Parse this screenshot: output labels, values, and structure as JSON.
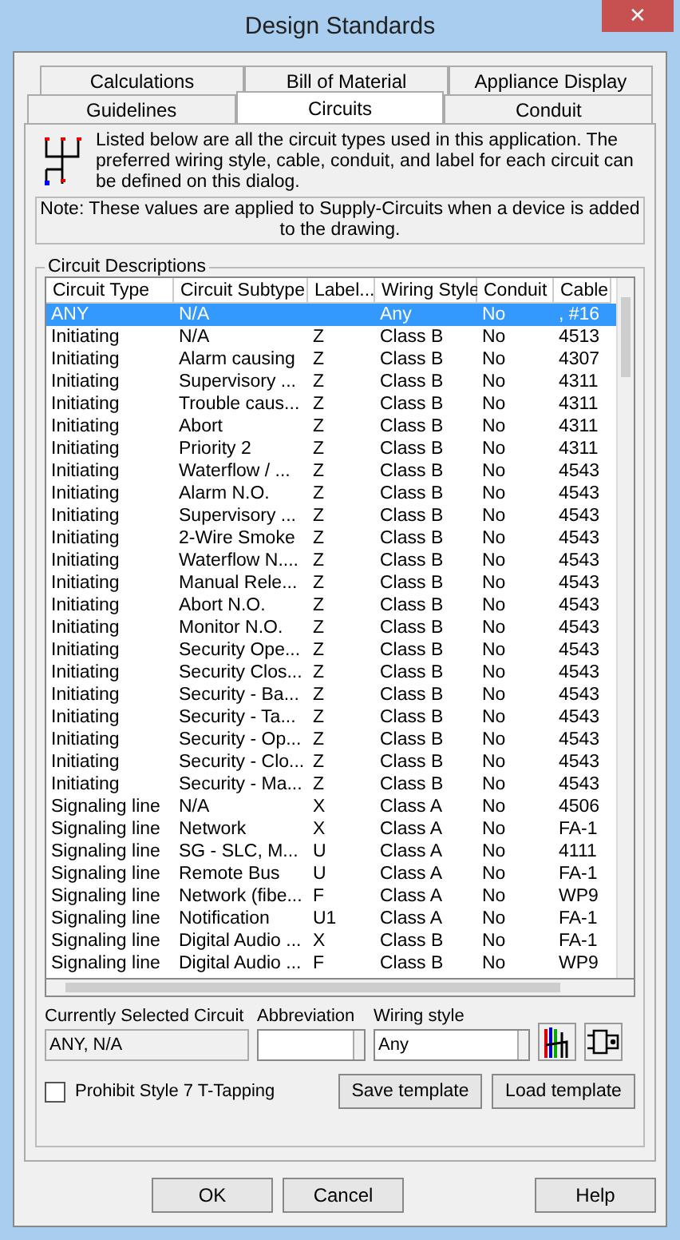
{
  "window": {
    "title": "Design Standards",
    "close": "✕"
  },
  "tab_rows": [
    [
      {
        "label": "Calculations",
        "selected": false
      },
      {
        "label": "Bill of Material",
        "selected": false
      },
      {
        "label": "Appliance Display",
        "selected": false
      }
    ],
    [
      {
        "label": "Guidelines",
        "selected": false
      },
      {
        "label": "Circuits",
        "selected": true
      },
      {
        "label": "Conduit",
        "selected": false
      }
    ]
  ],
  "intro": "Listed below are all the circuit types used in this application.  The preferred wiring style, cable, conduit, and label for each circuit can be defined on this dialog.",
  "note": "Note: These values are applied to Supply-Circuits when a device is added to the drawing.",
  "group_title": "Circuit Descriptions",
  "table": {
    "columns": [
      "Circuit Type",
      "Circuit Subtype",
      "Label...",
      "Wiring Style",
      "Conduit",
      "Cable"
    ],
    "rows": [
      {
        "cells": [
          "ANY",
          "N/A",
          "",
          "Any",
          "No",
          ", #16"
        ],
        "selected": true
      },
      {
        "cells": [
          "Initiating",
          "N/A",
          "Z",
          "Class B",
          "No",
          "4513"
        ],
        "selected": false
      },
      {
        "cells": [
          "Initiating",
          "Alarm causing",
          "Z",
          "Class B",
          "No",
          "4307"
        ],
        "selected": false
      },
      {
        "cells": [
          "Initiating",
          "Supervisory ...",
          "Z",
          "Class B",
          "No",
          "4311"
        ],
        "selected": false
      },
      {
        "cells": [
          "Initiating",
          "Trouble caus...",
          "Z",
          "Class B",
          "No",
          "4311"
        ],
        "selected": false
      },
      {
        "cells": [
          "Initiating",
          "Abort",
          "Z",
          "Class B",
          "No",
          "4311"
        ],
        "selected": false
      },
      {
        "cells": [
          "Initiating",
          "Priority 2",
          "Z",
          "Class B",
          "No",
          "4311"
        ],
        "selected": false
      },
      {
        "cells": [
          "Initiating",
          "Waterflow / ...",
          "Z",
          "Class B",
          "No",
          "4543"
        ],
        "selected": false
      },
      {
        "cells": [
          "Initiating",
          "Alarm N.O.",
          "Z",
          "Class B",
          "No",
          "4543"
        ],
        "selected": false
      },
      {
        "cells": [
          "Initiating",
          "Supervisory ...",
          "Z",
          "Class B",
          "No",
          "4543"
        ],
        "selected": false
      },
      {
        "cells": [
          "Initiating",
          "2-Wire Smoke",
          "Z",
          "Class B",
          "No",
          "4543"
        ],
        "selected": false
      },
      {
        "cells": [
          "Initiating",
          "Waterflow N....",
          "Z",
          "Class B",
          "No",
          "4543"
        ],
        "selected": false
      },
      {
        "cells": [
          "Initiating",
          "Manual Rele...",
          "Z",
          "Class B",
          "No",
          "4543"
        ],
        "selected": false
      },
      {
        "cells": [
          "Initiating",
          "Abort N.O.",
          "Z",
          "Class B",
          "No",
          "4543"
        ],
        "selected": false
      },
      {
        "cells": [
          "Initiating",
          "Monitor N.O.",
          "Z",
          "Class B",
          "No",
          "4543"
        ],
        "selected": false
      },
      {
        "cells": [
          "Initiating",
          "Security Ope...",
          "Z",
          "Class B",
          "No",
          "4543"
        ],
        "selected": false
      },
      {
        "cells": [
          "Initiating",
          "Security Clos...",
          "Z",
          "Class B",
          "No",
          "4543"
        ],
        "selected": false
      },
      {
        "cells": [
          "Initiating",
          "Security - Ba...",
          "Z",
          "Class B",
          "No",
          "4543"
        ],
        "selected": false
      },
      {
        "cells": [
          "Initiating",
          "Security - Ta...",
          "Z",
          "Class B",
          "No",
          "4543"
        ],
        "selected": false
      },
      {
        "cells": [
          "Initiating",
          "Security - Op...",
          "Z",
          "Class B",
          "No",
          "4543"
        ],
        "selected": false
      },
      {
        "cells": [
          "Initiating",
          "Security - Clo...",
          "Z",
          "Class B",
          "No",
          "4543"
        ],
        "selected": false
      },
      {
        "cells": [
          "Initiating",
          "Security - Ma...",
          "Z",
          "Class B",
          "No",
          "4543"
        ],
        "selected": false
      },
      {
        "cells": [
          "Signaling line",
          "N/A",
          "X",
          "Class A",
          "No",
          "4506"
        ],
        "selected": false
      },
      {
        "cells": [
          "Signaling line",
          "Network",
          "X",
          "Class A",
          "No",
          "FA-1"
        ],
        "selected": false
      },
      {
        "cells": [
          "Signaling line",
          "SG - SLC, M...",
          "U",
          "Class A",
          "No",
          "4111"
        ],
        "selected": false
      },
      {
        "cells": [
          "Signaling line",
          "Remote Bus",
          "U",
          "Class A",
          "No",
          "FA-1"
        ],
        "selected": false
      },
      {
        "cells": [
          "Signaling line",
          "Network (fibe...",
          "F",
          "Class A",
          "No",
          "WP9"
        ],
        "selected": false
      },
      {
        "cells": [
          "Signaling line",
          "Notification",
          "U1",
          "Class A",
          "No",
          "FA-1"
        ],
        "selected": false
      },
      {
        "cells": [
          "Signaling line",
          "Digital Audio ...",
          "X",
          "Class B",
          "No",
          "FA-1"
        ],
        "selected": false
      },
      {
        "cells": [
          "Signaling line",
          "Digital Audio ...",
          "F",
          "Class B",
          "No",
          "WP9"
        ],
        "selected": false
      }
    ]
  },
  "current": {
    "label": "Currently Selected Circuit",
    "value": "ANY, N/A"
  },
  "abbreviation": {
    "label": "Abbreviation"
  },
  "wiring_style": {
    "label": "Wiring style",
    "value": "Any"
  },
  "prohibit": {
    "label": "Prohibit Style 7 T-Tapping",
    "checked": false
  },
  "template_buttons": [
    "Save template",
    "Load template"
  ],
  "buttons": [
    "OK",
    "Cancel",
    "Help"
  ]
}
